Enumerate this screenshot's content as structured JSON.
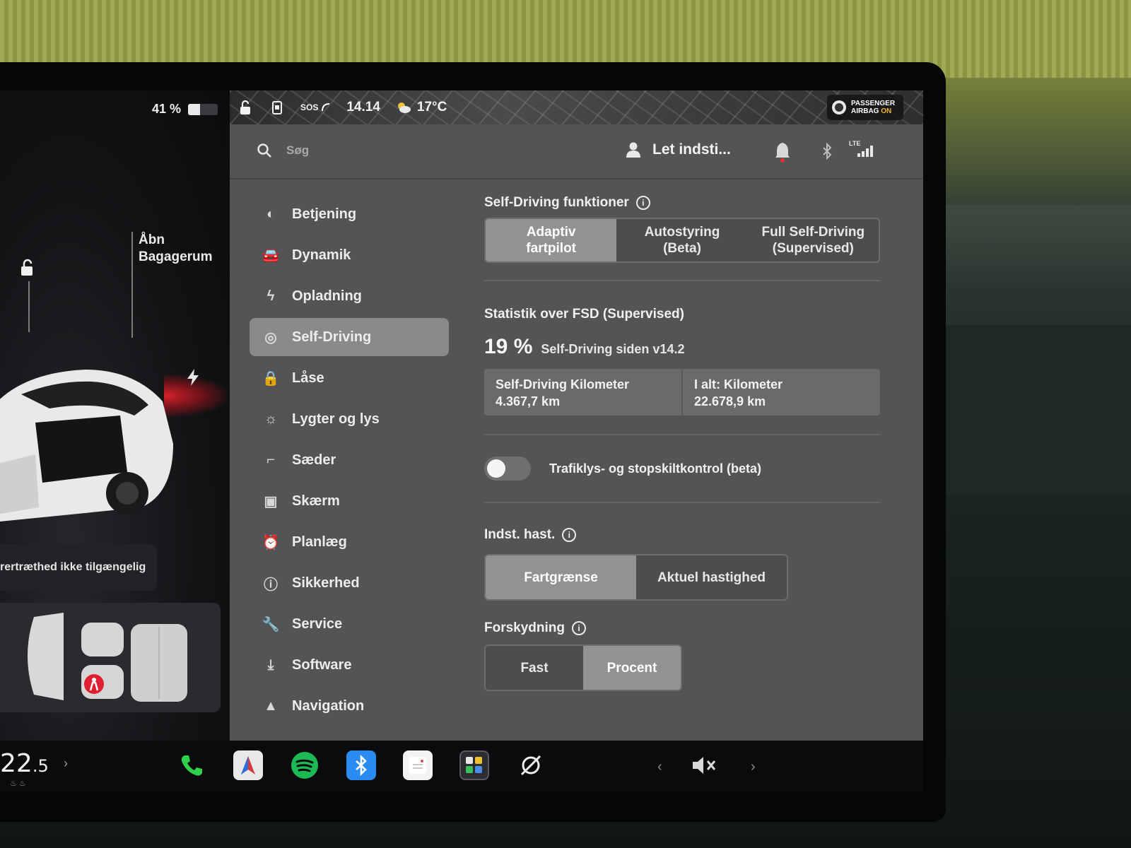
{
  "status": {
    "battery_text": "41 %",
    "battery_level": 0.41,
    "sos_label": "SOS",
    "time": "14.14",
    "temperature": "17°C",
    "airbag_line1": "PASSENGER",
    "airbag_line2": "AIRBAG",
    "airbag_state": "ON"
  },
  "car_panel": {
    "trunk_line1": "Åbn",
    "trunk_line2": "Bagagerum",
    "notice": "rertræthed ikke tilgængelig"
  },
  "topbar": {
    "search_placeholder": "Søg",
    "profile_name": "Let indsti...",
    "lte_label": "LTE"
  },
  "nav": {
    "items": [
      {
        "label": "Betjening",
        "icon": "toggle-icon"
      },
      {
        "label": "Dynamik",
        "icon": "car-icon"
      },
      {
        "label": "Opladning",
        "icon": "bolt-icon"
      },
      {
        "label": "Self-Driving",
        "icon": "steering-wheel-icon",
        "active": true
      },
      {
        "label": "Låse",
        "icon": "lock-icon"
      },
      {
        "label": "Lygter og lys",
        "icon": "sun-icon"
      },
      {
        "label": "Sæder",
        "icon": "seat-icon"
      },
      {
        "label": "Skærm",
        "icon": "display-icon"
      },
      {
        "label": "Planlæg",
        "icon": "alarm-clock-icon"
      },
      {
        "label": "Sikkerhed",
        "icon": "alert-circle-icon"
      },
      {
        "label": "Service",
        "icon": "wrench-icon"
      },
      {
        "label": "Software",
        "icon": "download-icon"
      },
      {
        "label": "Navigation",
        "icon": "navigation-icon"
      }
    ]
  },
  "content": {
    "features_title": "Self-Driving funktioner",
    "feature_options": [
      {
        "line1": "Adaptiv",
        "line2": "fartpilot",
        "selected": true
      },
      {
        "line1": "Autostyring",
        "line2": "(Beta)",
        "selected": false
      },
      {
        "line1": "Full Self-Driving",
        "line2": "(Supervised)",
        "selected": false
      }
    ],
    "stats_title": "Statistik over FSD (Supervised)",
    "stats_percent": "19 %",
    "stats_since": "Self-Driving siden v14.2",
    "stats_cells": [
      {
        "label": "Self-Driving Kilometer",
        "value": "4.367,7 km"
      },
      {
        "label": "I alt: Kilometer",
        "value": "22.678,9 km"
      }
    ],
    "traffic_toggle_label": "Trafiklys- og stopskiltkontrol (beta)",
    "traffic_toggle_on": false,
    "speed_title": "Indst. hast.",
    "speed_options": [
      {
        "label": "Fartgrænse",
        "selected": true
      },
      {
        "label": "Aktuel hastighed",
        "selected": false
      }
    ],
    "offset_title": "Forskydning",
    "offset_options": [
      {
        "label": "Fast",
        "selected": false
      },
      {
        "label": "Procent",
        "selected": true
      }
    ]
  },
  "dock": {
    "cabin_temp_main": "22",
    "cabin_temp_decimal": ".5",
    "apps": [
      "phone-icon",
      "navigation-app-icon",
      "spotify-icon",
      "bluetooth-icon",
      "calendar-icon",
      "app-launcher-icon",
      "camera-off-icon"
    ],
    "volume_state": "muted"
  },
  "colors": {
    "panel_bg": "#545457",
    "selected_segment": "#929295",
    "active_nav": "#8a8a8d",
    "spotify_green": "#1db954",
    "phone_green": "#2fd04a",
    "bluetooth_blue": "#2a8cf0"
  }
}
